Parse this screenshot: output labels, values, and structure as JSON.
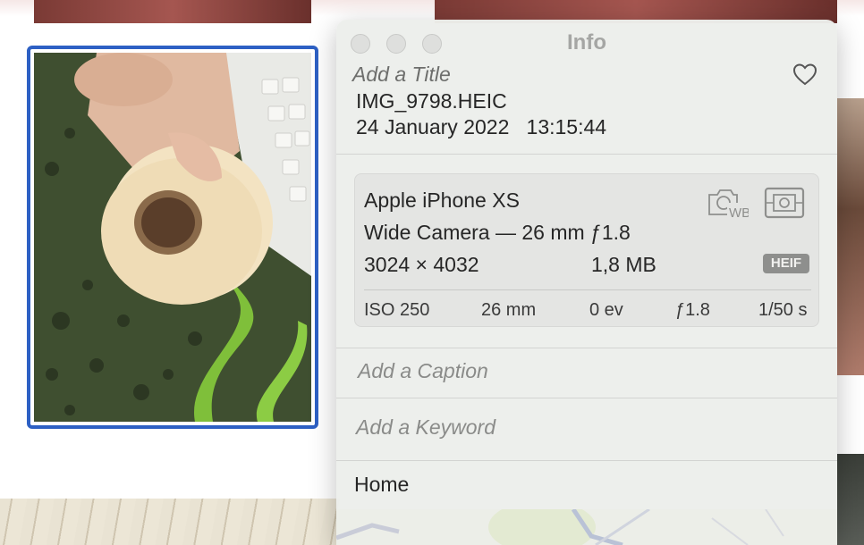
{
  "window": {
    "title": "Info"
  },
  "info": {
    "title_placeholder": "Add a Title",
    "filename": "IMG_9798.HEIC",
    "date": "24 January 2022",
    "time": "13:15:44"
  },
  "camera": {
    "model": "Apple iPhone XS",
    "lens": "Wide Camera — 26 mm ƒ1.8",
    "dimensions": "3024 × 4032",
    "file_size": "1,8 MB",
    "format_badge": "HEIF",
    "exif": {
      "iso": "ISO 250",
      "focal_length": "26 mm",
      "exposure_bias": "0 ev",
      "aperture": "ƒ1.8",
      "shutter": "1/50 s"
    }
  },
  "caption_placeholder": "Add a Caption",
  "keyword_placeholder": "Add a Keyword",
  "location": "Home",
  "icons": {
    "favorite": "heart-icon",
    "white_balance": "camera-wb-icon",
    "metering": "metering-mode-icon"
  },
  "colors": {
    "selection_border": "#2d60c4",
    "panel_background": "#eceeeb"
  }
}
